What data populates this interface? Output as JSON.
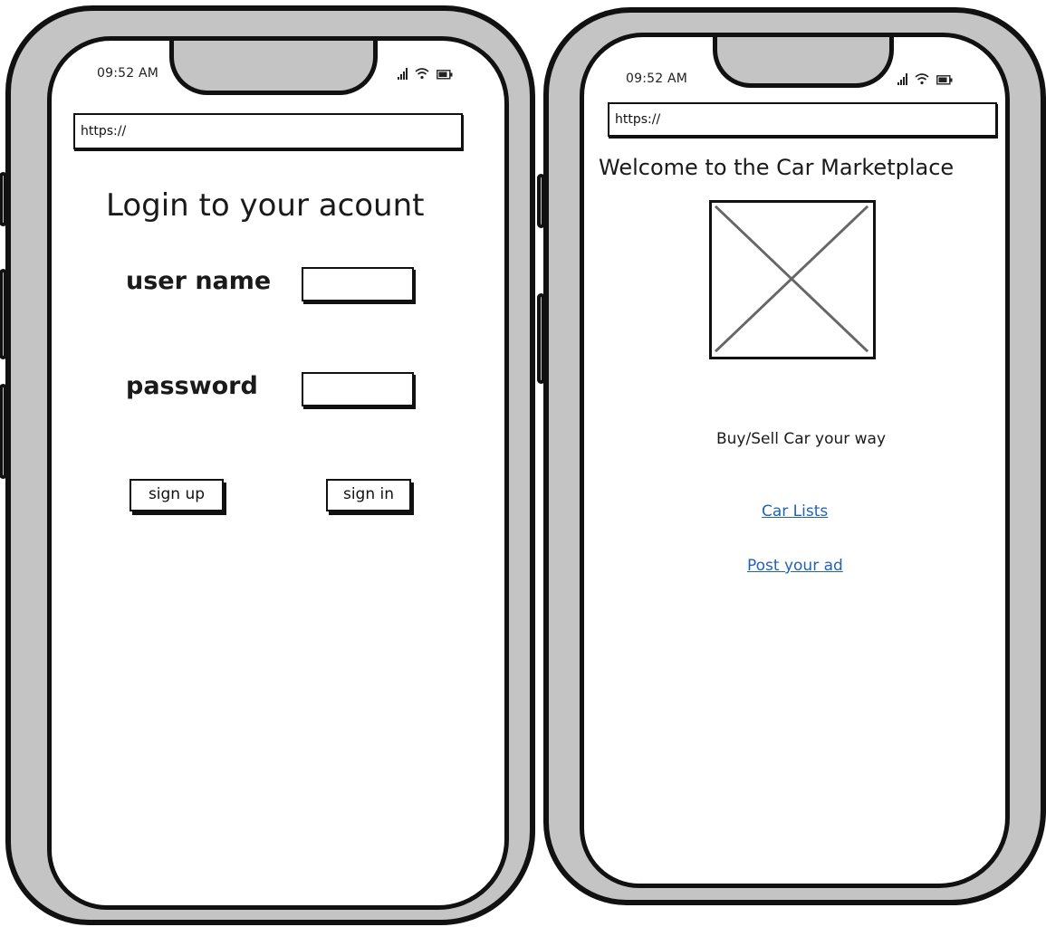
{
  "login_phone": {
    "status": {
      "time": "09:52 AM"
    },
    "url": "https://",
    "title": "Login to your acount",
    "username_label": "user name",
    "password_label": "password",
    "signup_label": "sign up",
    "signin_label": "sign in"
  },
  "home_phone": {
    "status": {
      "time": "09:52 AM"
    },
    "url": "https://",
    "title": "Welcome to the Car Marketplace",
    "tagline": "Buy/Sell Car your way",
    "links": {
      "car_lists": "Car Lists",
      "post_ad": "Post your ad"
    }
  },
  "colors": {
    "frame": "#c4c4c4",
    "outline": "#111111",
    "link": "#1f63b8"
  },
  "icons": [
    "signal-icon",
    "wifi-icon",
    "battery-icon",
    "image-placeholder-icon"
  ]
}
